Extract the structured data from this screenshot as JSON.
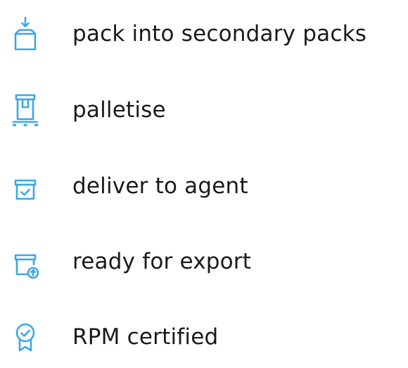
{
  "accent_color": "#3ea6e3",
  "text_color": "#1a1a1a",
  "items": [
    {
      "icon": "box-arrow-down-icon",
      "label": "pack into secondary packs"
    },
    {
      "icon": "box-on-pallet-icon",
      "label": "palletise"
    },
    {
      "icon": "box-check-icon",
      "label": "deliver to agent"
    },
    {
      "icon": "box-upload-icon",
      "label": "ready for export"
    },
    {
      "icon": "certified-badge-icon",
      "label": "RPM certified"
    }
  ]
}
